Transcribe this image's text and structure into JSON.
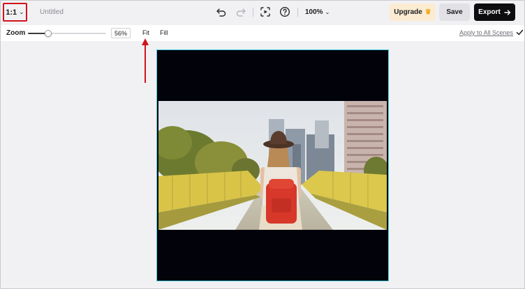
{
  "topbar": {
    "aspect_ratio": "1:1",
    "document_title": "Untitled",
    "zoom_level": "100%",
    "upgrade_label": "Upgrade",
    "save_label": "Save",
    "export_label": "Export"
  },
  "toolbar": {
    "zoom_label": "Zoom",
    "zoom_value": "56%",
    "zoom_fraction": 0.56,
    "fit_label": "Fit",
    "fill_label": "Fill",
    "apply_all_label": "Apply to All Scenes"
  },
  "colors": {
    "accent_cyan": "#43d3dc",
    "annotation_red": "#d0141b",
    "upgrade_bg": "#fcebd3",
    "export_bg": "#0d0d10"
  },
  "icons": {
    "aspect_chevron": "chevron-down-icon",
    "undo": "undo-icon",
    "redo": "redo-icon",
    "screen_capture": "screen-capture-icon",
    "help": "help-icon",
    "crown": "crown-icon",
    "export_arrow": "arrow-right-icon",
    "confirm": "check-icon"
  }
}
